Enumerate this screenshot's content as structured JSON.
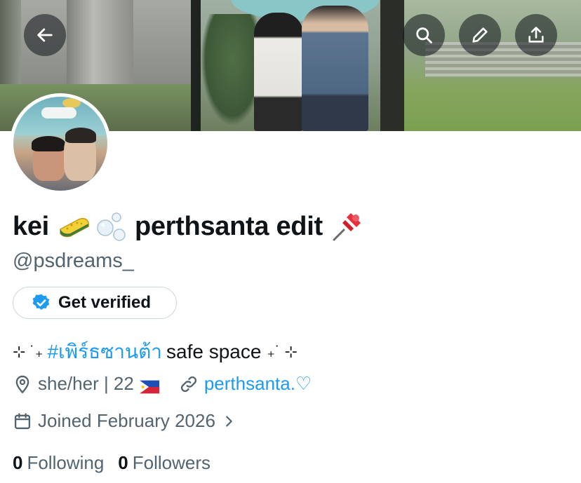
{
  "profile": {
    "name_part1": "kei",
    "name_part2": "perthsanta edit",
    "handle": "@psdreams_",
    "verify_label": "Get verified",
    "bio": {
      "sparkle_left": "⊹ ˙₊",
      "hashtag": "#เพิร์ธซานต้า",
      "text": "safe space",
      "sparkle_right": "₊˙ ⊹"
    },
    "location": "she/her | 22",
    "website": "perthsanta.♡",
    "joined": "Joined February 2026",
    "following_count": "0",
    "following_label": "Following",
    "followers_count": "0",
    "followers_label": "Followers"
  },
  "icons": {
    "back": "back-arrow-icon",
    "search": "search-icon",
    "edit": "pencil-icon",
    "share": "share-icon",
    "verified": "verified-badge-icon",
    "location": "location-pin-icon",
    "link": "link-icon",
    "calendar": "calendar-icon",
    "chevron": "chevron-right-icon"
  },
  "colors": {
    "accent": "#1d9bf0",
    "text_primary": "#0f1419",
    "text_secondary": "#536471",
    "border": "#cfd9de"
  }
}
